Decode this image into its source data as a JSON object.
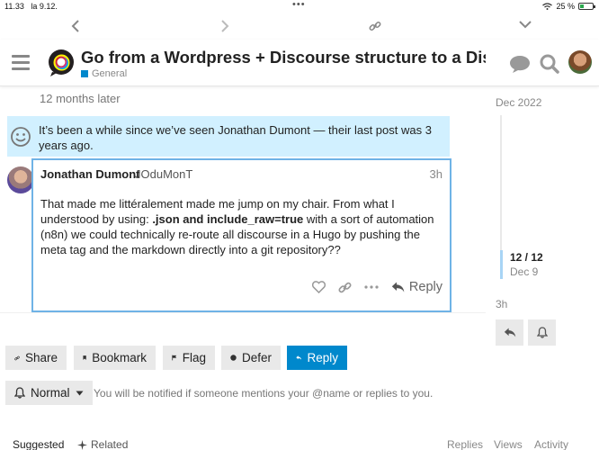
{
  "status_bar": {
    "time": "11.33",
    "date": "la 9.12.",
    "battery": "25 %"
  },
  "header": {
    "title": "Go from a Wordpress + Discourse structure to a Disco",
    "category": "General",
    "category_color": "#0088cc",
    "icons": [
      "hamburger-icon",
      "chat-icon",
      "search-icon",
      "avatar"
    ]
  },
  "time_gap": "12 months later",
  "notice": {
    "text": "It’s been a while since we’ve seen Jonathan Dumont — their last post was 3 years ago."
  },
  "post": {
    "author": "Jonathan Dumont",
    "username": "JOduMonT",
    "time": "3h",
    "body_part1": "That made me littéralement made me jump on my chair. From what I understood by using: ",
    "body_bold": ".json and include_raw=true",
    "body_part2": " with a sort of automation (n8n) we could technically re-route all discourse in a Hugo by pushing the meta tag and the markdown directly into a git repository??",
    "reply_label": "Reply"
  },
  "timeline": {
    "date_top": "Dec 2022",
    "position": "12 / 12",
    "position_date": "Dec 9",
    "date_bottom": "3h"
  },
  "footer": {
    "share": "Share",
    "bookmark": "Bookmark",
    "flag": "Flag",
    "defer": "Defer",
    "reply": "Reply",
    "notification_level": "Normal",
    "notification_text": "You will be notified if someone mentions your @name or replies to you."
  },
  "bottom_tabs": {
    "suggested": "Suggested",
    "related": "Related",
    "replies": "Replies",
    "views": "Views",
    "activity": "Activity"
  },
  "colors": {
    "accent": "#0088cc",
    "notice_bg": "#d1f0ff",
    "post_border": "#6fb3e6"
  }
}
